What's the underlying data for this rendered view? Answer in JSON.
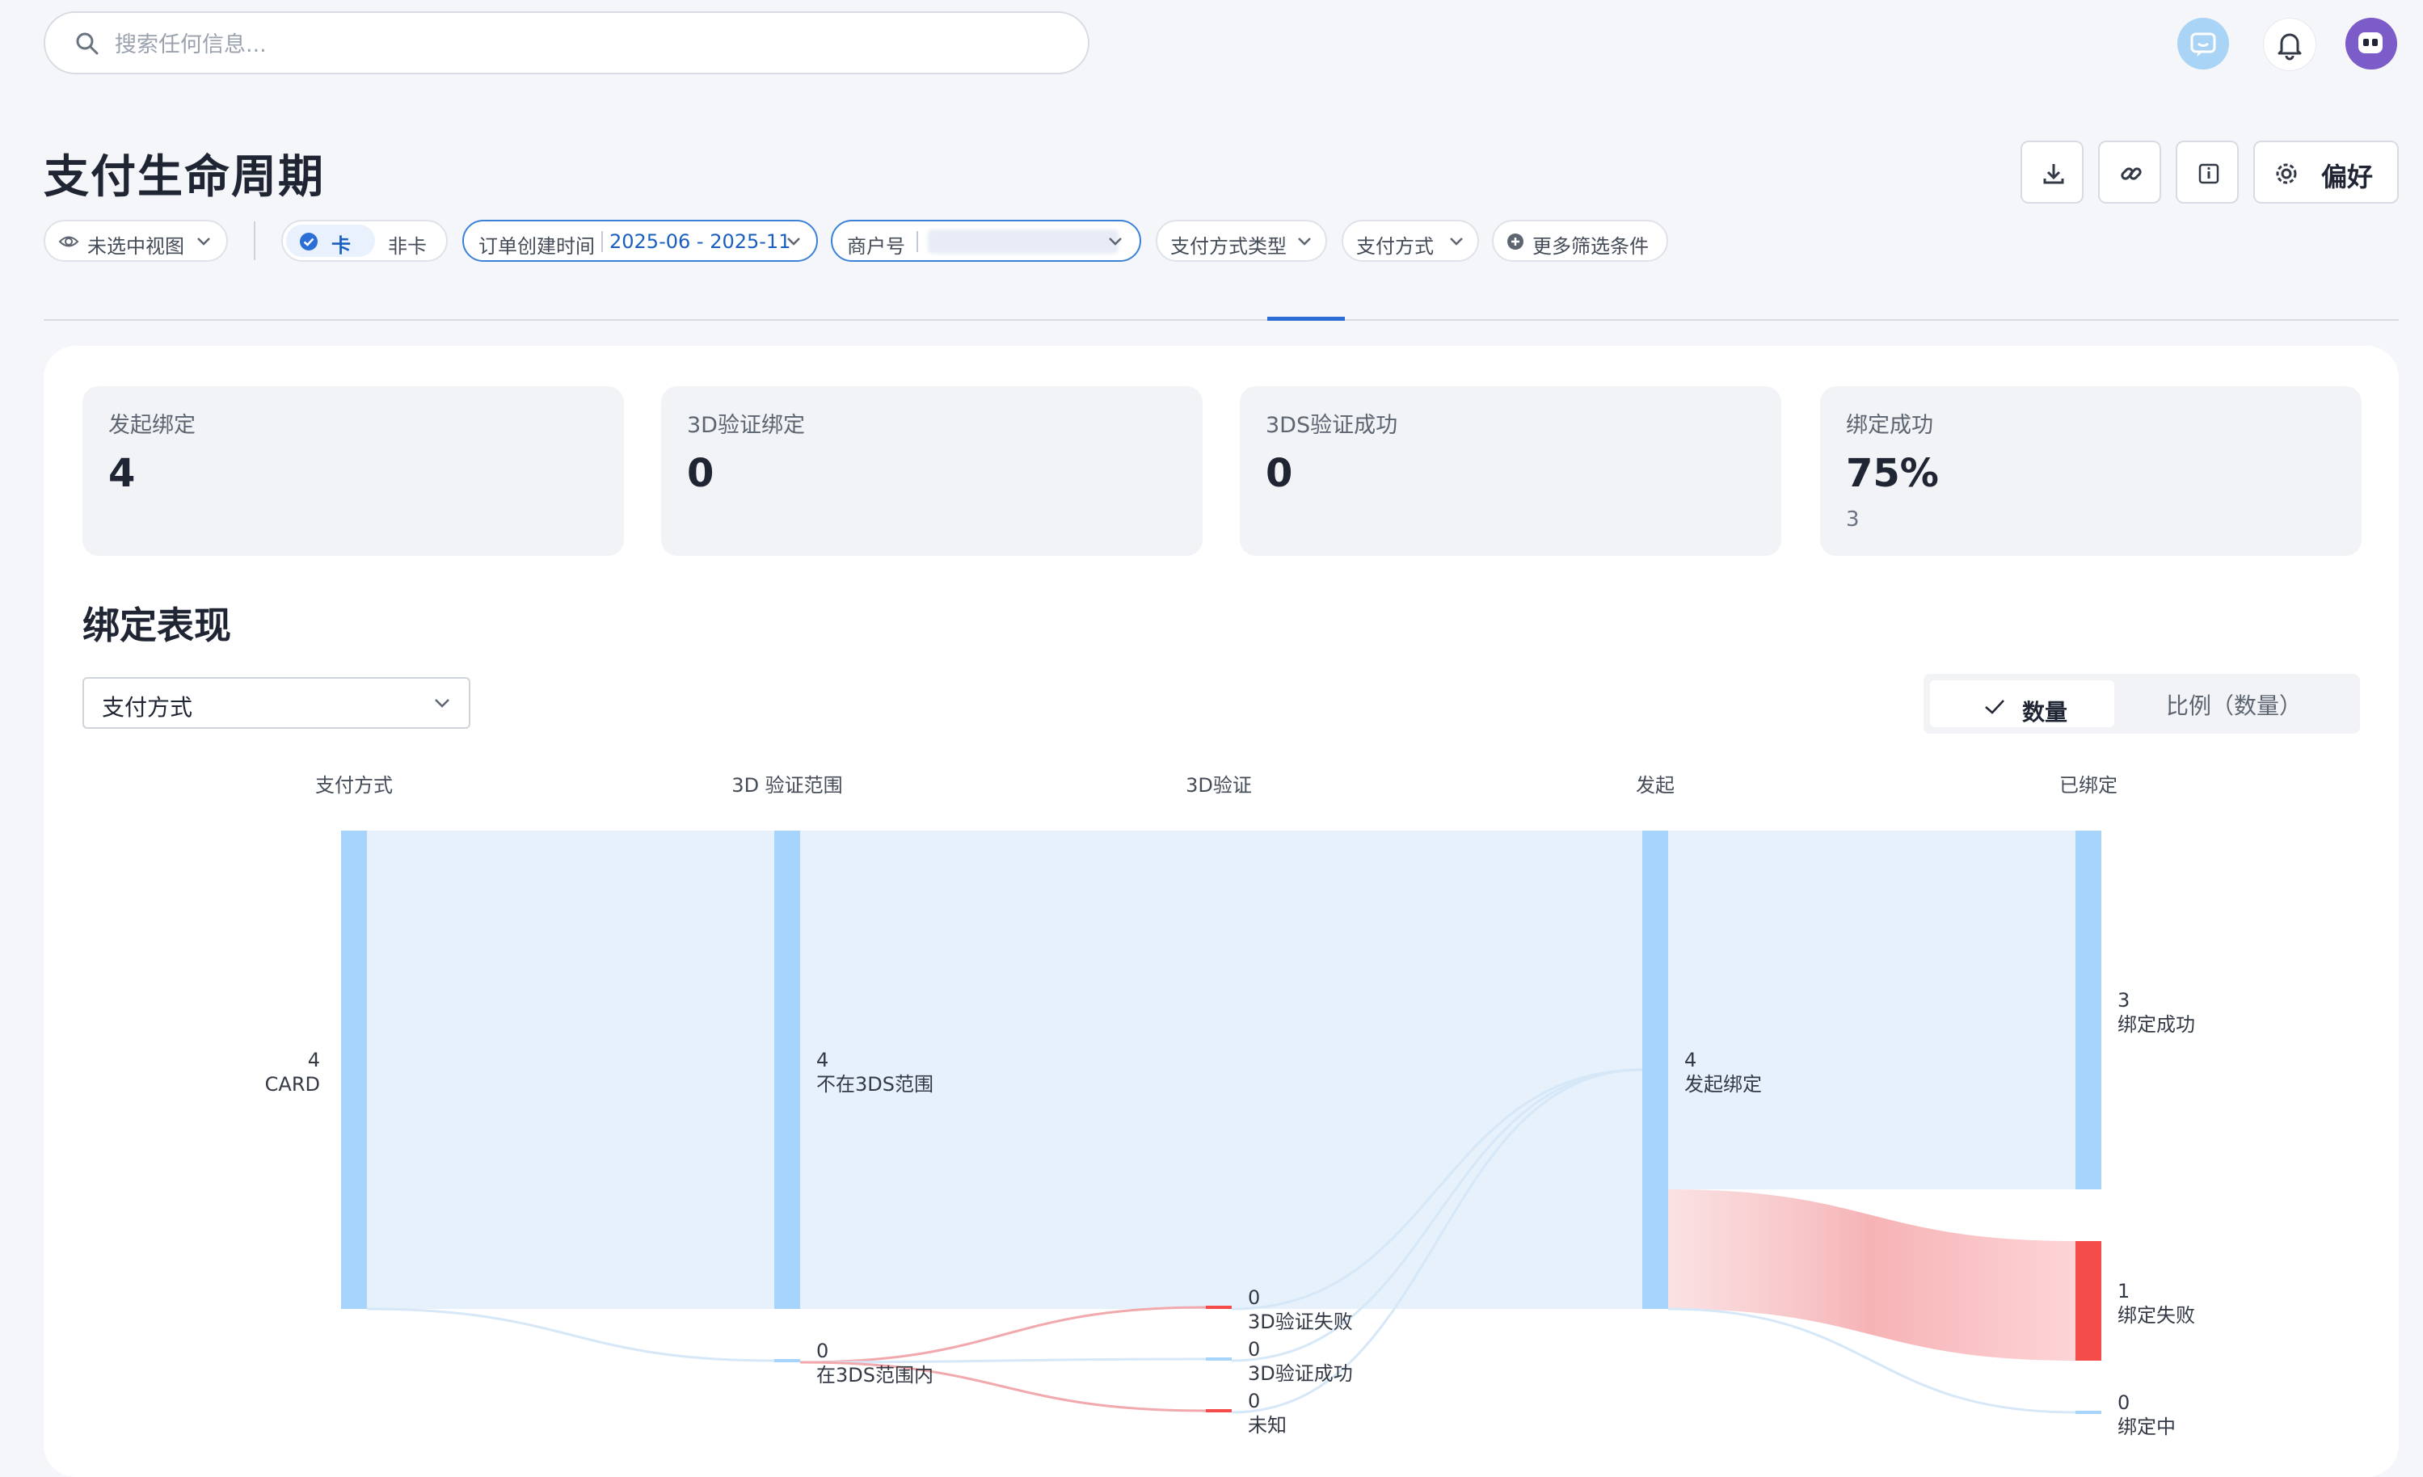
{
  "search": {
    "placeholder": "搜索任何信息..."
  },
  "header": {
    "title": "支付生命周期",
    "preferences_label": "偏好"
  },
  "filters": {
    "view_label": "未选中视图",
    "card_seg": {
      "selected": "卡",
      "other": "非卡"
    },
    "order_time": {
      "label": "订单创建时间",
      "value": "2025-06 - 2025-11"
    },
    "merchant": {
      "label": "商户号"
    },
    "method_type_label": "支付方式类型",
    "method_label": "支付方式",
    "more_label": "更多筛选条件"
  },
  "kpis": [
    {
      "label": "发起绑定",
      "value": "4",
      "sub": ""
    },
    {
      "label": "3D验证绑定",
      "value": "0",
      "sub": ""
    },
    {
      "label": "3DS验证成功",
      "value": "0",
      "sub": ""
    },
    {
      "label": "绑定成功",
      "value": "75%",
      "sub": "3"
    }
  ],
  "section": {
    "title": "绑定表现",
    "group_by": "支付方式",
    "toggle": {
      "selected": "数量",
      "other": "比例（数量）"
    }
  },
  "chart_data": {
    "type": "sankey",
    "columns": [
      "支付方式",
      "3D 验证范围",
      "3D验证",
      "发起",
      "已绑定"
    ],
    "nodes": [
      {
        "id": "card",
        "column": 0,
        "label": "CARD",
        "value": 4
      },
      {
        "id": "not3ds",
        "column": 1,
        "label": "不在3DS范围",
        "value": 4
      },
      {
        "id": "in3ds",
        "column": 1,
        "label": "在3DS范围内",
        "value": 0
      },
      {
        "id": "fail3d",
        "column": 2,
        "label": "3D验证失败",
        "value": 0
      },
      {
        "id": "ok3d",
        "column": 2,
        "label": "3D验证成功",
        "value": 0
      },
      {
        "id": "unknown",
        "column": 2,
        "label": "未知",
        "value": 0
      },
      {
        "id": "init",
        "column": 3,
        "label": "发起绑定",
        "value": 4
      },
      {
        "id": "bound",
        "column": 4,
        "label": "绑定成功",
        "value": 3
      },
      {
        "id": "bindfail",
        "column": 4,
        "label": "绑定失败",
        "value": 1
      },
      {
        "id": "binding",
        "column": 4,
        "label": "绑定中",
        "value": 0
      }
    ],
    "links": [
      {
        "source": "card",
        "target": "not3ds",
        "value": 4
      },
      {
        "source": "card",
        "target": "in3ds",
        "value": 0
      },
      {
        "source": "not3ds",
        "target": "init",
        "value": 4
      },
      {
        "source": "in3ds",
        "target": "fail3d",
        "value": 0
      },
      {
        "source": "in3ds",
        "target": "ok3d",
        "value": 0
      },
      {
        "source": "in3ds",
        "target": "unknown",
        "value": 0
      },
      {
        "source": "fail3d",
        "target": "init",
        "value": 0
      },
      {
        "source": "ok3d",
        "target": "init",
        "value": 0
      },
      {
        "source": "unknown",
        "target": "init",
        "value": 0
      },
      {
        "source": "init",
        "target": "bound",
        "value": 3
      },
      {
        "source": "init",
        "target": "bindfail",
        "value": 1
      },
      {
        "source": "init",
        "target": "binding",
        "value": 0
      }
    ],
    "colors": {
      "node": "#a6d4fa",
      "fail": "#f44b4b",
      "link": "#e6f1fc",
      "fail_link": "#f6b3b6"
    }
  }
}
